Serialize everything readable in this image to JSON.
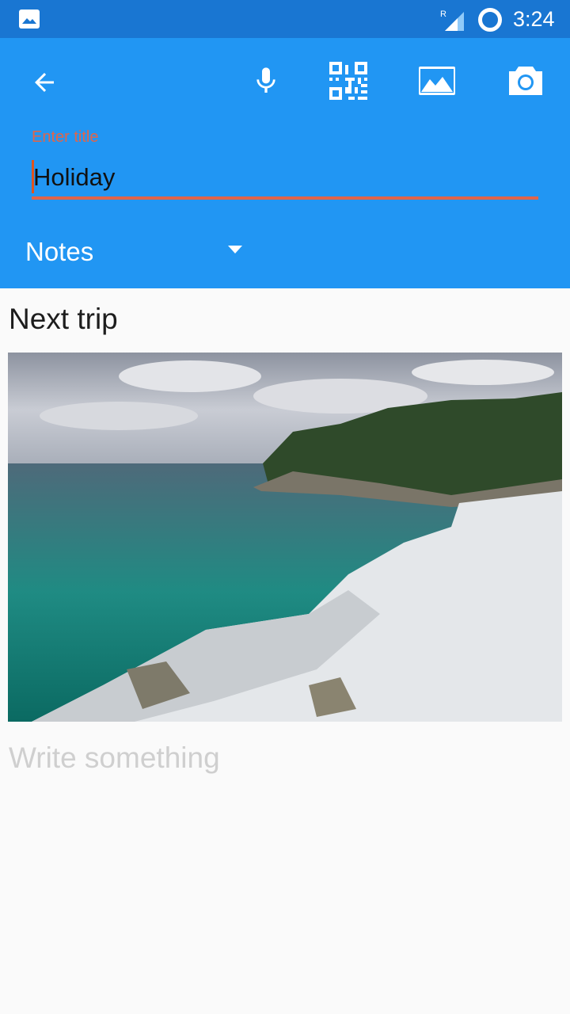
{
  "status_bar": {
    "time": "3:24",
    "notification_icon": "gallery-icon",
    "roaming_indicator": "R"
  },
  "toolbar": {
    "back_icon": "arrow-back-icon",
    "actions": [
      {
        "name": "microphone",
        "icon": "mic-icon"
      },
      {
        "name": "qr-code",
        "icon": "qr-code-icon"
      },
      {
        "name": "image",
        "icon": "image-icon"
      },
      {
        "name": "camera",
        "icon": "camera-icon"
      }
    ],
    "title_label": "Enter title",
    "title_value": "Holiday",
    "category_selected": "Notes"
  },
  "note": {
    "heading": "Next trip",
    "image_alt": "Rocky snow-covered shoreline with turquoise water and evergreen forest",
    "body_placeholder": "Write something"
  },
  "colors": {
    "status_bar": "#1976d2",
    "primary": "#2196f3",
    "accent": "#e0654a",
    "background": "#fafafa"
  }
}
